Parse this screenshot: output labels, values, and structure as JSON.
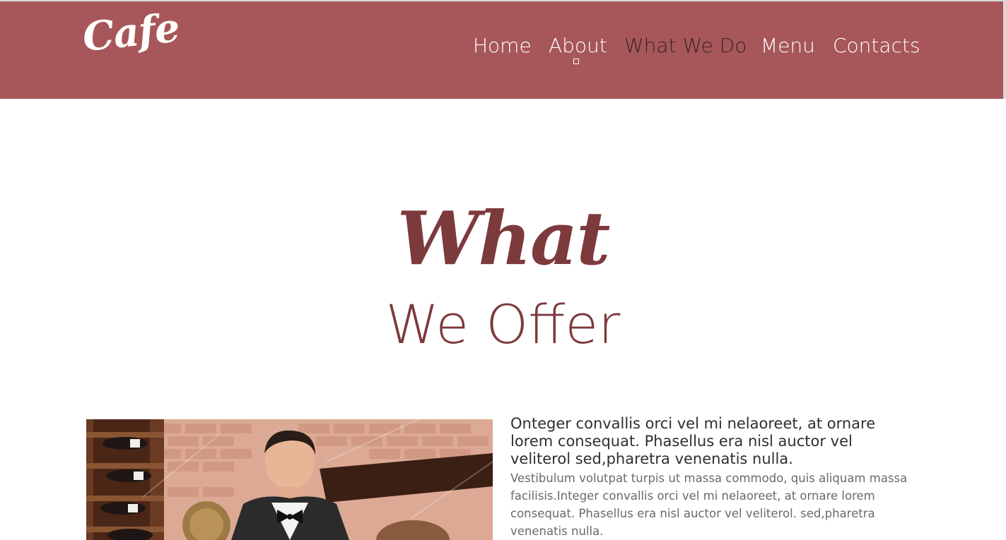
{
  "header": {
    "logo": "Cafe",
    "nav": [
      "Home",
      "About",
      "What We Do",
      "Menu",
      "Contacts"
    ],
    "active_nav": "What We Do",
    "background_color": "#a75759"
  },
  "section": {
    "title_script": "What",
    "title_sub": "We Offer",
    "title_color": "#7d3a3c"
  },
  "feature": {
    "image_alt": "waiter",
    "lead": "Onteger convallis orci vel mi nelaoreet, at ornare lorem consequat. Phasellus era nisl auctor vel veliterol sed,pharetra venenatis nulla.",
    "body": "Vestibulum volutpat turpis ut massa commodo, quis aliquam massa facilisis.Integer convallis orci vel mi nelaoreet, at ornare lorem consequat. Phasellus era nisl auctor vel veliterol. sed,pharetra venenatis nulla."
  }
}
